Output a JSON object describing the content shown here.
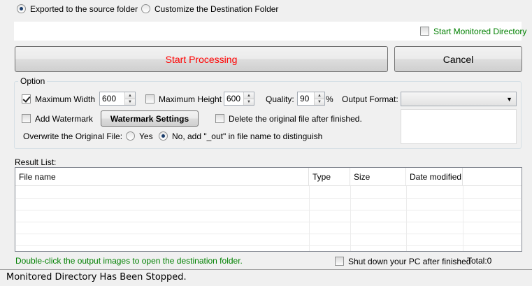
{
  "output_options": {
    "source_folder_label": "Exported to the source folder",
    "custom_folder_label": "Customize the Destination Folder",
    "selected": "source"
  },
  "monitor": {
    "label": "Start Monitored Directory",
    "color": "#008000",
    "checked": false
  },
  "actions": {
    "start_label": "Start Processing",
    "start_color": "#ff0000",
    "cancel_label": "Cancel"
  },
  "option": {
    "title": "Option",
    "max_width_label": "Maximum Width",
    "max_width_checked": true,
    "max_width_value": "600",
    "max_height_label": "Maximum Height",
    "max_height_checked": false,
    "max_height_value": "600",
    "quality_label": "Quality:",
    "quality_value": "90",
    "quality_unit": "%",
    "output_format_label": "Output Format:",
    "output_format_value": "",
    "add_watermark_label": "Add Watermark",
    "watermark_settings_label": "Watermark Settings",
    "delete_original_label": "Delete the original file after finished.",
    "overwrite_label": "Overwrite the Original File:",
    "overwrite_yes_label": "Yes",
    "overwrite_no_label": "No, add \"_out\" in file name to distinguish",
    "overwrite_selected": "no"
  },
  "results": {
    "title": "Result List:",
    "columns": [
      "File name",
      "Type",
      "Size",
      "Date modified"
    ],
    "rows": []
  },
  "footer": {
    "hint": "Double-click the output images to open the destination folder.",
    "hint_color": "#008000",
    "shutdown_label": "Shut down your PC after finished",
    "total_label": "Total:0"
  },
  "status_bar": {
    "text": "Monitored Directory Has Been Stopped."
  }
}
